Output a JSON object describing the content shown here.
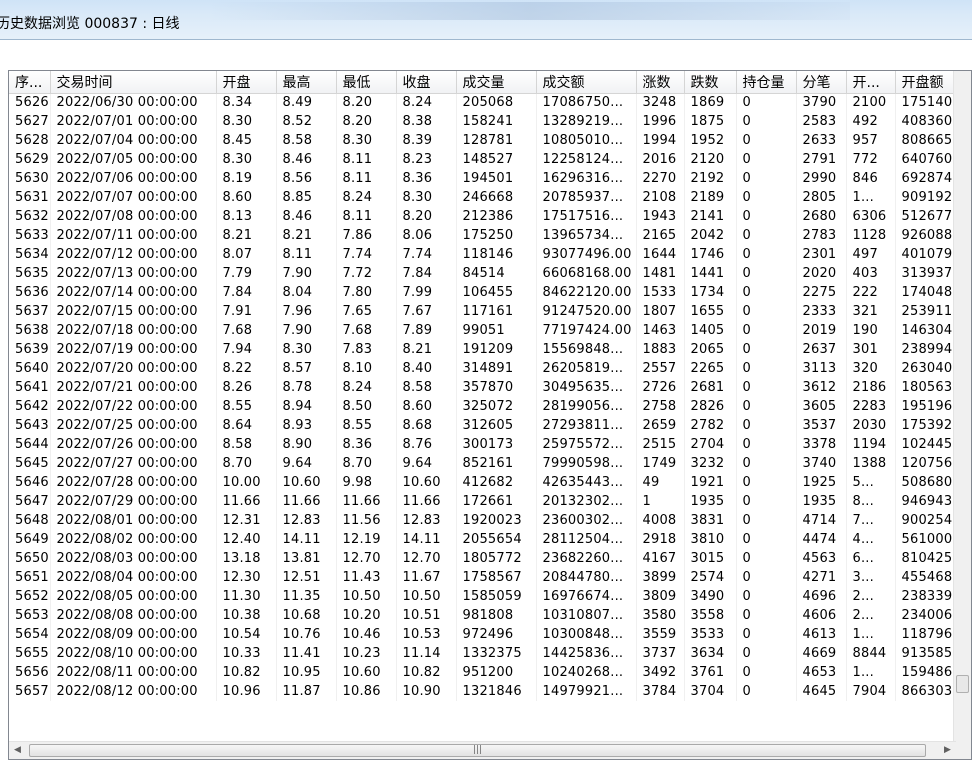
{
  "window": {
    "title": "历史数据浏览 000837 : 日线"
  },
  "table": {
    "columns": [
      "序...",
      "交易时间",
      "开盘",
      "最高",
      "最低",
      "收盘",
      "成交量",
      "成交额",
      "涨数",
      "跌数",
      "持仓量",
      "分笔",
      "开...",
      "开盘额"
    ],
    "rows": [
      [
        "5626",
        "2022/06/30  00:00:00",
        "8.34",
        "8.49",
        "8.20",
        "8.24",
        "205068",
        "17086750...",
        "3248",
        "1869",
        "0",
        "3790",
        "2100",
        "175140..."
      ],
      [
        "5627",
        "2022/07/01  00:00:00",
        "8.30",
        "8.52",
        "8.20",
        "8.38",
        "158241",
        "13289219...",
        "1996",
        "1875",
        "0",
        "2583",
        "492",
        "408360..."
      ],
      [
        "5628",
        "2022/07/04  00:00:00",
        "8.45",
        "8.58",
        "8.30",
        "8.39",
        "128781",
        "10805010...",
        "1994",
        "1952",
        "0",
        "2633",
        "957",
        "808665..."
      ],
      [
        "5629",
        "2022/07/05  00:00:00",
        "8.30",
        "8.46",
        "8.11",
        "8.23",
        "148527",
        "12258124...",
        "2016",
        "2120",
        "0",
        "2791",
        "772",
        "640760..."
      ],
      [
        "5630",
        "2022/07/06  00:00:00",
        "8.19",
        "8.56",
        "8.11",
        "8.36",
        "194501",
        "16296316...",
        "2270",
        "2192",
        "0",
        "2990",
        "846",
        "692874..."
      ],
      [
        "5631",
        "2022/07/07  00:00:00",
        "8.60",
        "8.85",
        "8.24",
        "8.30",
        "246668",
        "20785937...",
        "2108",
        "2189",
        "0",
        "2805",
        "1...",
        "909192..."
      ],
      [
        "5632",
        "2022/07/08  00:00:00",
        "8.13",
        "8.46",
        "8.11",
        "8.20",
        "212386",
        "17517516...",
        "1943",
        "2141",
        "0",
        "2680",
        "6306",
        "512677..."
      ],
      [
        "5633",
        "2022/07/11  00:00:00",
        "8.21",
        "8.21",
        "7.86",
        "8.06",
        "175250",
        "13965734...",
        "2165",
        "2042",
        "0",
        "2783",
        "1128",
        "926088..."
      ],
      [
        "5634",
        "2022/07/12  00:00:00",
        "8.07",
        "8.11",
        "7.74",
        "7.74",
        "118146",
        "93077496.00",
        "1644",
        "1746",
        "0",
        "2301",
        "497",
        "401079..."
      ],
      [
        "5635",
        "2022/07/13  00:00:00",
        "7.79",
        "7.90",
        "7.72",
        "7.84",
        "84514",
        "66068168.00",
        "1481",
        "1441",
        "0",
        "2020",
        "403",
        "313937..."
      ],
      [
        "5636",
        "2022/07/14  00:00:00",
        "7.84",
        "8.04",
        "7.80",
        "7.99",
        "106455",
        "84622120.00",
        "1533",
        "1734",
        "0",
        "2275",
        "222",
        "174048..."
      ],
      [
        "5637",
        "2022/07/15  00:00:00",
        "7.91",
        "7.96",
        "7.65",
        "7.67",
        "117161",
        "91247520.00",
        "1807",
        "1655",
        "0",
        "2333",
        "321",
        "253911..."
      ],
      [
        "5638",
        "2022/07/18  00:00:00",
        "7.68",
        "7.90",
        "7.68",
        "7.89",
        "99051",
        "77197424.00",
        "1463",
        "1405",
        "0",
        "2019",
        "190",
        "146304..."
      ],
      [
        "5639",
        "2022/07/19  00:00:00",
        "7.94",
        "8.30",
        "7.83",
        "8.21",
        "191209",
        "15569848...",
        "1883",
        "2065",
        "0",
        "2637",
        "301",
        "238994..."
      ],
      [
        "5640",
        "2022/07/20  00:00:00",
        "8.22",
        "8.57",
        "8.10",
        "8.40",
        "314891",
        "26205819...",
        "2557",
        "2265",
        "0",
        "3113",
        "320",
        "263040..."
      ],
      [
        "5641",
        "2022/07/21  00:00:00",
        "8.26",
        "8.78",
        "8.24",
        "8.58",
        "357870",
        "30495635...",
        "2726",
        "2681",
        "0",
        "3612",
        "2186",
        "180563..."
      ],
      [
        "5642",
        "2022/07/22  00:00:00",
        "8.55",
        "8.94",
        "8.50",
        "8.60",
        "325072",
        "28199056...",
        "2758",
        "2826",
        "0",
        "3605",
        "2283",
        "195196..."
      ],
      [
        "5643",
        "2022/07/25  00:00:00",
        "8.64",
        "8.93",
        "8.55",
        "8.68",
        "312605",
        "27293811...",
        "2659",
        "2782",
        "0",
        "3537",
        "2030",
        "175392..."
      ],
      [
        "5644",
        "2022/07/26  00:00:00",
        "8.58",
        "8.90",
        "8.36",
        "8.76",
        "300173",
        "25975572...",
        "2515",
        "2704",
        "0",
        "3378",
        "1194",
        "102445..."
      ],
      [
        "5645",
        "2022/07/27  00:00:00",
        "8.70",
        "9.64",
        "8.70",
        "9.64",
        "852161",
        "79990598...",
        "1749",
        "3232",
        "0",
        "3740",
        "1388",
        "120756..."
      ],
      [
        "5646",
        "2022/07/28  00:00:00",
        "10.00",
        "10.60",
        "9.98",
        "10.60",
        "412682",
        "42635443...",
        "49",
        "1921",
        "0",
        "1925",
        "5...",
        "508680..."
      ],
      [
        "5647",
        "2022/07/29  00:00:00",
        "11.66",
        "11.66",
        "11.66",
        "11.66",
        "172661",
        "20132302...",
        "1",
        "1935",
        "0",
        "1935",
        "8...",
        "946943..."
      ],
      [
        "5648",
        "2022/08/01  00:00:00",
        "12.31",
        "12.83",
        "11.56",
        "12.83",
        "1920023",
        "23600302...",
        "4008",
        "3831",
        "0",
        "4714",
        "7...",
        "900254..."
      ],
      [
        "5649",
        "2022/08/02  00:00:00",
        "12.40",
        "14.11",
        "12.19",
        "14.11",
        "2055654",
        "28112504...",
        "2918",
        "3810",
        "0",
        "4474",
        "4...",
        "561000..."
      ],
      [
        "5650",
        "2022/08/03  00:00:00",
        "13.18",
        "13.81",
        "12.70",
        "12.70",
        "1805772",
        "23682260...",
        "4167",
        "3015",
        "0",
        "4563",
        "6...",
        "810425..."
      ],
      [
        "5651",
        "2022/08/04  00:00:00",
        "12.30",
        "12.51",
        "11.43",
        "11.67",
        "1758567",
        "20844780...",
        "3899",
        "2574",
        "0",
        "4271",
        "3...",
        "455468..."
      ],
      [
        "5652",
        "2022/08/05  00:00:00",
        "11.30",
        "11.35",
        "10.50",
        "10.50",
        "1585059",
        "16976674...",
        "3809",
        "3490",
        "0",
        "4696",
        "2...",
        "238339..."
      ],
      [
        "5653",
        "2022/08/08  00:00:00",
        "10.38",
        "10.68",
        "10.20",
        "10.51",
        "981808",
        "10310807...",
        "3580",
        "3558",
        "0",
        "4606",
        "2...",
        "234006..."
      ],
      [
        "5654",
        "2022/08/09  00:00:00",
        "10.54",
        "10.76",
        "10.46",
        "10.53",
        "972496",
        "10300848...",
        "3559",
        "3533",
        "0",
        "4613",
        "1...",
        "118796..."
      ],
      [
        "5655",
        "2022/08/10  00:00:00",
        "10.33",
        "11.41",
        "10.23",
        "11.14",
        "1332375",
        "14425836...",
        "3737",
        "3634",
        "0",
        "4669",
        "8844",
        "913585..."
      ],
      [
        "5656",
        "2022/08/11  00:00:00",
        "10.82",
        "10.95",
        "10.60",
        "10.82",
        "951200",
        "10240268...",
        "3492",
        "3761",
        "0",
        "4653",
        "1...",
        "159486..."
      ],
      [
        "5657",
        "2022/08/12  00:00:00",
        "10.96",
        "11.87",
        "10.86",
        "10.90",
        "1321846",
        "14979921...",
        "3784",
        "3704",
        "0",
        "4645",
        "7904",
        "866303..."
      ]
    ]
  },
  "scrollbar": {
    "h_grip": "|||",
    "left_arrow": "◀",
    "right_arrow": "▶"
  }
}
